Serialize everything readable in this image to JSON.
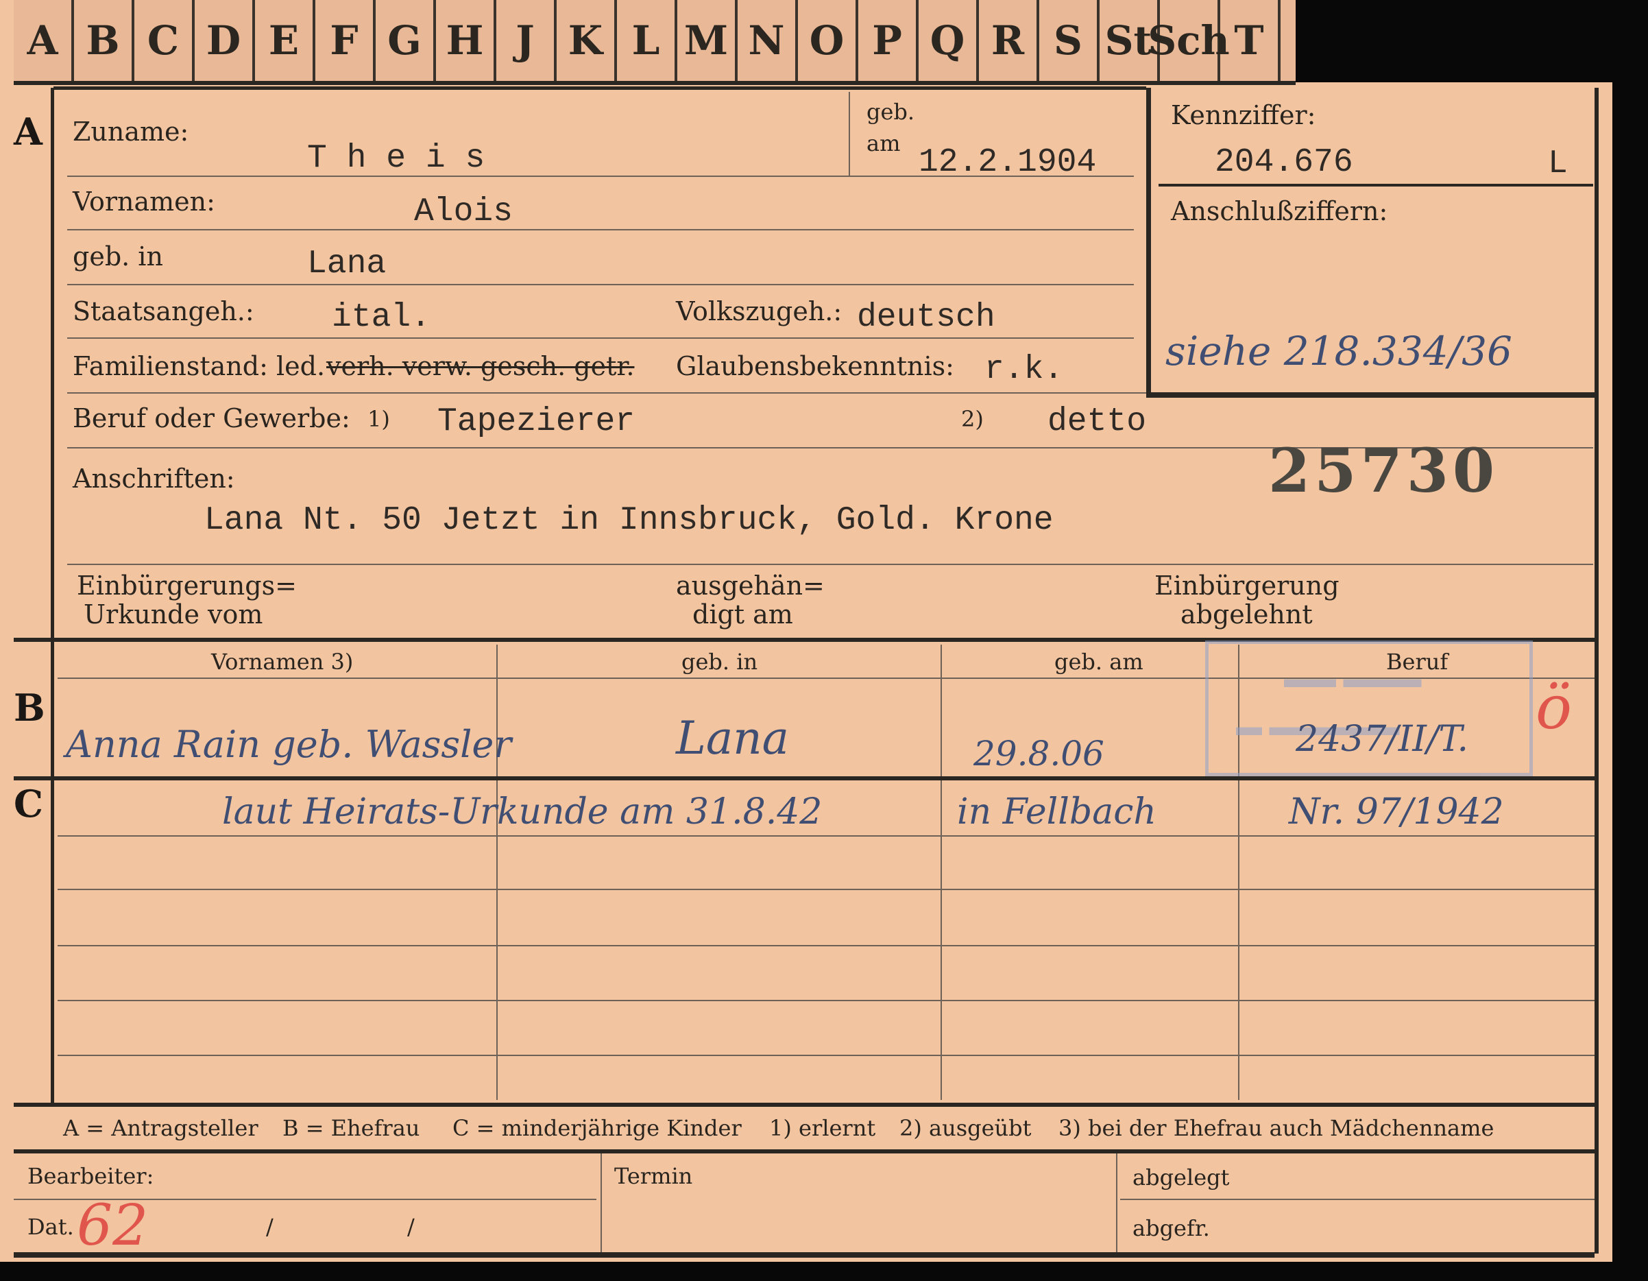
{
  "tabs": [
    "A",
    "B",
    "C",
    "D",
    "E",
    "F",
    "G",
    "H",
    "J",
    "K",
    "L",
    "M",
    "N",
    "O",
    "P",
    "Q",
    "R",
    "S",
    "St",
    "Sch",
    "T"
  ],
  "sections": {
    "a": "A",
    "b": "B",
    "c": "C"
  },
  "a": {
    "surname_label": "Zuname:",
    "surname": "T h e i s",
    "born_on_label_1": "geb.",
    "born_on_label_2": "am",
    "born_on": "12.2.1904",
    "ref_label": "Kennziffer:",
    "ref_number": "204.676",
    "ref_suffix": "L",
    "link_label": "Anschlußziffern:",
    "link_note": "siehe 218.334/36",
    "first_names_label": "Vornamen:",
    "first_names": "Alois",
    "born_in_label": "geb. in",
    "born_in": "Lana",
    "citizenship_label": "Staatsangeh.:",
    "citizenship": "ital.",
    "ethnicity_label": "Volkszugeh.:",
    "ethnicity": "deutsch",
    "marital_label": "Familienstand: led.",
    "marital_struck": "verh. verw. gesch. getr.",
    "religion_label": "Glaubensbekenntnis:",
    "religion": "r.k.",
    "occupation_label": "Beruf oder Gewerbe:",
    "note1": "1)",
    "occupation_learned": "Tapezierer",
    "note2": "2)",
    "occupation_practiced": "detto",
    "file_number": "25730",
    "addresses_label": "Anschriften:",
    "address": "Lana Nt. 50 Jetzt in Innsbruck, Gold. Krone",
    "naturalization_doc_label_1": "Einbürgerungs=",
    "naturalization_doc_label_2": "Urkunde vom",
    "handed_out_label_1": "ausgehän=",
    "handed_out_label_2": "digt am",
    "rejected_label_1": "Einbürgerung",
    "rejected_label_2": "abgelehnt"
  },
  "b": {
    "col_first_names": "Vornamen 3)",
    "col_born_in": "geb. in",
    "col_born_on": "geb. am",
    "col_occupation": "Beruf",
    "wife_name": "Anna Rain geb. Wassler",
    "wife_born_in": "Lana",
    "wife_born_on": "29.8.06",
    "wife_ref": "2437/II/T.",
    "red_mark": "ö"
  },
  "c": {
    "marriage_note_1": "laut Heirats-Urkunde am 31.8.42",
    "marriage_note_2": "in Fellbach",
    "marriage_note_3": "Nr. 97/1942"
  },
  "legend": {
    "a": "A = Antragsteller",
    "b": "B = Ehefrau",
    "c": "C = minderjährige Kinder",
    "n1": "1) erlernt",
    "n2": "2) ausgeübt",
    "n3": "3) bei der Ehefrau auch Mädchenname"
  },
  "footer": {
    "clerk_label": "Bearbeiter:",
    "date_label": "Dat.",
    "date_value": "62",
    "slash": "/",
    "deadline_label": "Termin",
    "filed_label": "abgelegt",
    "retrieved_label": "abgefr."
  },
  "colors": {
    "card": "#f2c5a0",
    "ink_blue": "#3f4e72",
    "ink_red": "#e0564c",
    "stamp": "#8ea0c9"
  }
}
